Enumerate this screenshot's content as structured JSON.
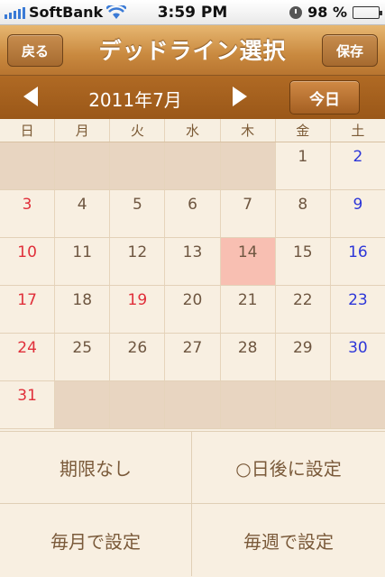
{
  "status_bar": {
    "carrier": "SoftBank",
    "time": "3:59 PM",
    "battery": "98 %",
    "battery_level": 0.98
  },
  "nav": {
    "back_label": "戻る",
    "title": "デッドライン選択",
    "save_label": "保存"
  },
  "month_bar": {
    "month_label": "2011年7月",
    "today_label": "今日"
  },
  "calendar": {
    "weekdays": [
      "日",
      "月",
      "火",
      "水",
      "木",
      "金",
      "土"
    ],
    "weeks": [
      [
        "",
        "",
        "",
        "",
        "",
        "1",
        "2"
      ],
      [
        "3",
        "4",
        "5",
        "6",
        "7",
        "8",
        "9"
      ],
      [
        "10",
        "11",
        "12",
        "13",
        "14",
        "15",
        "16"
      ],
      [
        "17",
        "18",
        "19",
        "20",
        "21",
        "22",
        "23"
      ],
      [
        "24",
        "25",
        "26",
        "27",
        "28",
        "29",
        "30"
      ],
      [
        "31",
        "",
        "",
        "",
        "",
        "",
        ""
      ]
    ],
    "selected_day": "14",
    "holiday_day": "19"
  },
  "options": {
    "no_limit": "期限なし",
    "days_after": "○日後に設定",
    "monthly": "毎月で設定",
    "weekly": "毎週で設定"
  }
}
